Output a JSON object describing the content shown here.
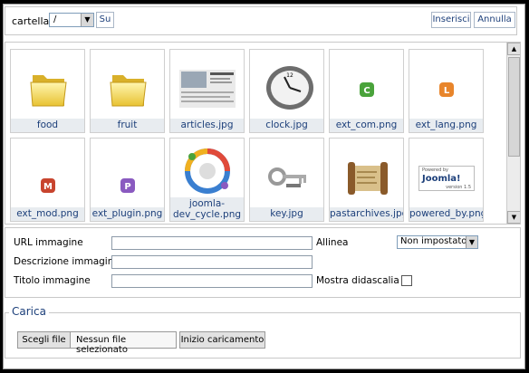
{
  "toolbar": {
    "folder_label": "cartella",
    "folder_value": "/",
    "up_label": "Su",
    "insert_label": "Inserisci",
    "cancel_label": "Annulla"
  },
  "gallery": {
    "items": [
      {
        "name": "food",
        "type": "folder"
      },
      {
        "name": "fruit",
        "type": "folder"
      },
      {
        "name": "articles.jpg",
        "type": "image"
      },
      {
        "name": "clock.jpg",
        "type": "image"
      },
      {
        "name": "ext_com.png",
        "type": "badge",
        "letter": "C",
        "color": "#4aa33b"
      },
      {
        "name": "ext_lang.png",
        "type": "badge",
        "letter": "L",
        "color": "#e8852b"
      },
      {
        "name": "ext_mod.png",
        "type": "badge",
        "letter": "M",
        "color": "#c8442e"
      },
      {
        "name": "ext_plugin.png",
        "type": "badge",
        "letter": "P",
        "color": "#8a5ac0"
      },
      {
        "name": "joomla-dev_cycle.png",
        "type": "image",
        "name_line1": "joomla-",
        "name_line2": "dev_cycle.png"
      },
      {
        "name": "key.jpg",
        "type": "image"
      },
      {
        "name": "pastarchives.jpg",
        "type": "image"
      },
      {
        "name": "powered_by.png",
        "type": "image",
        "logo_top": "Powered by",
        "logo_main": "Joomla!",
        "logo_sub": "version 1.5"
      }
    ]
  },
  "form": {
    "url_label": "URL immagine",
    "desc_label": "Descrizione immagine",
    "title_label": "Titolo immagine",
    "align_label": "Allinea",
    "align_value": "Non impostato",
    "caption_label": "Mostra didascalia",
    "caption_checked": false
  },
  "upload": {
    "legend": "Carica",
    "choose_label": "Scegli file",
    "status": "Nessun file selezionato",
    "start_label": "Inizio caricamento"
  }
}
